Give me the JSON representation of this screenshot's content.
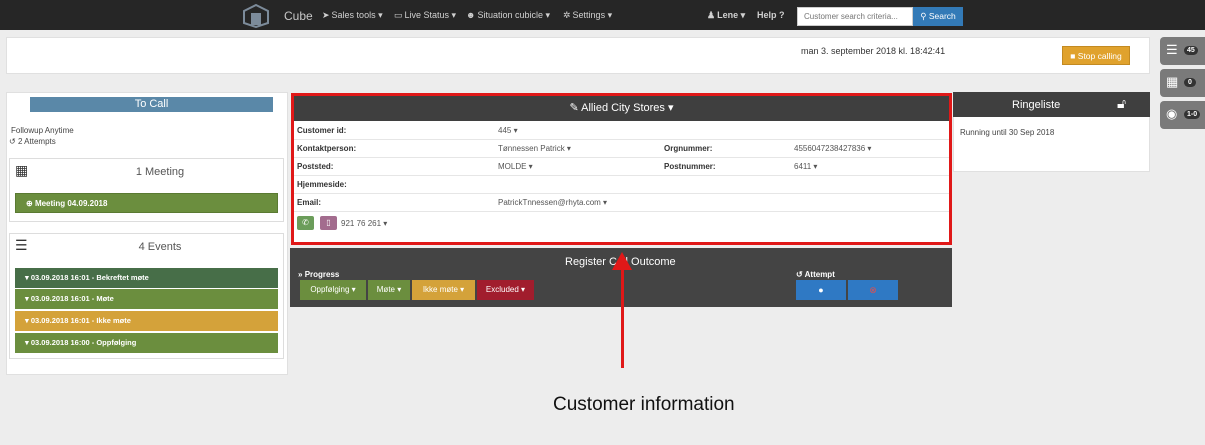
{
  "colors": {
    "highlight": "#e01818",
    "navbar": "#262626",
    "accent_blue": "#337ab7",
    "stop_orange": "#e0a22d"
  },
  "navbar": {
    "brand": "Cube",
    "items": [
      {
        "icon": "paper-plane-icon",
        "glyph": "➤",
        "label": "Sales tools ▾"
      },
      {
        "icon": "monitor-icon",
        "glyph": "▭",
        "label": "Live Status ▾"
      },
      {
        "icon": "users-icon",
        "glyph": "☻",
        "label": "Situation cubicle ▾"
      },
      {
        "icon": "gear-icon",
        "glyph": "✲",
        "label": "Settings ▾"
      }
    ],
    "user": "Lene ▾",
    "help": "Help",
    "search_placeholder": "Customer search criteria...",
    "search_button": "Search"
  },
  "top": {
    "datetime": "man 3. september 2018 kl. 18:42:41",
    "stop_button": "Stop calling"
  },
  "side_tabs": [
    {
      "icon": "list-icon",
      "badge": "45"
    },
    {
      "icon": "calendar-icon",
      "badge": "0"
    },
    {
      "icon": "gamepad-icon",
      "badge": "1-0"
    }
  ],
  "left": {
    "header": "To Call",
    "followup": "Followup Anytime",
    "attempts": "2 Attempts",
    "meetings_title": "1 Meeting",
    "meeting_button": "Meeting 04.09.2018",
    "events_title": "4 Events",
    "events": [
      "03.09.2018 16:01 - Bekreftet møte",
      "03.09.2018 16:01 - Møte",
      "03.09.2018 16:01 - Ikke møte",
      "03.09.2018 16:00 - Oppfølging"
    ]
  },
  "customer": {
    "name": "Allied City Stores ▾",
    "labels": {
      "customer_id": "Customer id:",
      "contact": "Kontaktperson:",
      "place": "Poststed:",
      "website": "Hjemmeside:",
      "email": "Email:",
      "org": "Orgnummer:",
      "postcode": "Postnummer:"
    },
    "values": {
      "customer_id": "445 ▾",
      "contact": "Tønnessen Patrick ▾",
      "place": "MOLDE ▾",
      "email": "PatrickTnnessen@rhyta.com ▾",
      "org": "4556047238427836 ▾",
      "postcode": "6411 ▾"
    },
    "phone": "921 76 261 ▾"
  },
  "ringeliste": {
    "title": "Ringeliste",
    "running": "Running until 30 Sep 2018"
  },
  "outcome": {
    "title": "Register Call Outcome",
    "progress_label": "Progress",
    "attempt_label": "Attempt",
    "buttons": [
      {
        "label": "Oppfølging ▾",
        "color": "#6b8e3e"
      },
      {
        "label": "Møte ▾",
        "color": "#6b8e3e"
      },
      {
        "label": "Ikke møte ▾",
        "color": "#d4a23a"
      },
      {
        "label": "Excluded ▾",
        "color": "#a11d2d"
      }
    ]
  },
  "annotation": "Customer information"
}
